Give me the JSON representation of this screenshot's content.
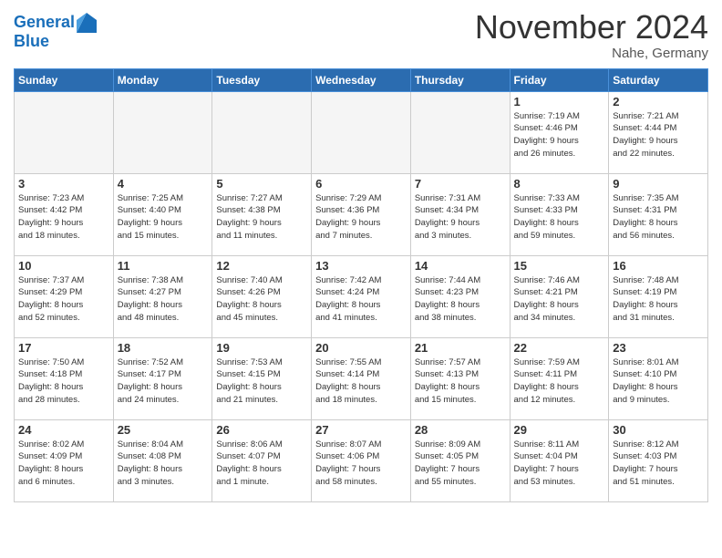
{
  "header": {
    "logo_line1": "General",
    "logo_line2": "Blue",
    "month": "November 2024",
    "location": "Nahe, Germany"
  },
  "weekdays": [
    "Sunday",
    "Monday",
    "Tuesday",
    "Wednesday",
    "Thursday",
    "Friday",
    "Saturday"
  ],
  "days": [
    {
      "num": "",
      "info": ""
    },
    {
      "num": "",
      "info": ""
    },
    {
      "num": "",
      "info": ""
    },
    {
      "num": "",
      "info": ""
    },
    {
      "num": "",
      "info": ""
    },
    {
      "num": "1",
      "info": "Sunrise: 7:19 AM\nSunset: 4:46 PM\nDaylight: 9 hours\nand 26 minutes."
    },
    {
      "num": "2",
      "info": "Sunrise: 7:21 AM\nSunset: 4:44 PM\nDaylight: 9 hours\nand 22 minutes."
    },
    {
      "num": "3",
      "info": "Sunrise: 7:23 AM\nSunset: 4:42 PM\nDaylight: 9 hours\nand 18 minutes."
    },
    {
      "num": "4",
      "info": "Sunrise: 7:25 AM\nSunset: 4:40 PM\nDaylight: 9 hours\nand 15 minutes."
    },
    {
      "num": "5",
      "info": "Sunrise: 7:27 AM\nSunset: 4:38 PM\nDaylight: 9 hours\nand 11 minutes."
    },
    {
      "num": "6",
      "info": "Sunrise: 7:29 AM\nSunset: 4:36 PM\nDaylight: 9 hours\nand 7 minutes."
    },
    {
      "num": "7",
      "info": "Sunrise: 7:31 AM\nSunset: 4:34 PM\nDaylight: 9 hours\nand 3 minutes."
    },
    {
      "num": "8",
      "info": "Sunrise: 7:33 AM\nSunset: 4:33 PM\nDaylight: 8 hours\nand 59 minutes."
    },
    {
      "num": "9",
      "info": "Sunrise: 7:35 AM\nSunset: 4:31 PM\nDaylight: 8 hours\nand 56 minutes."
    },
    {
      "num": "10",
      "info": "Sunrise: 7:37 AM\nSunset: 4:29 PM\nDaylight: 8 hours\nand 52 minutes."
    },
    {
      "num": "11",
      "info": "Sunrise: 7:38 AM\nSunset: 4:27 PM\nDaylight: 8 hours\nand 48 minutes."
    },
    {
      "num": "12",
      "info": "Sunrise: 7:40 AM\nSunset: 4:26 PM\nDaylight: 8 hours\nand 45 minutes."
    },
    {
      "num": "13",
      "info": "Sunrise: 7:42 AM\nSunset: 4:24 PM\nDaylight: 8 hours\nand 41 minutes."
    },
    {
      "num": "14",
      "info": "Sunrise: 7:44 AM\nSunset: 4:23 PM\nDaylight: 8 hours\nand 38 minutes."
    },
    {
      "num": "15",
      "info": "Sunrise: 7:46 AM\nSunset: 4:21 PM\nDaylight: 8 hours\nand 34 minutes."
    },
    {
      "num": "16",
      "info": "Sunrise: 7:48 AM\nSunset: 4:19 PM\nDaylight: 8 hours\nand 31 minutes."
    },
    {
      "num": "17",
      "info": "Sunrise: 7:50 AM\nSunset: 4:18 PM\nDaylight: 8 hours\nand 28 minutes."
    },
    {
      "num": "18",
      "info": "Sunrise: 7:52 AM\nSunset: 4:17 PM\nDaylight: 8 hours\nand 24 minutes."
    },
    {
      "num": "19",
      "info": "Sunrise: 7:53 AM\nSunset: 4:15 PM\nDaylight: 8 hours\nand 21 minutes."
    },
    {
      "num": "20",
      "info": "Sunrise: 7:55 AM\nSunset: 4:14 PM\nDaylight: 8 hours\nand 18 minutes."
    },
    {
      "num": "21",
      "info": "Sunrise: 7:57 AM\nSunset: 4:13 PM\nDaylight: 8 hours\nand 15 minutes."
    },
    {
      "num": "22",
      "info": "Sunrise: 7:59 AM\nSunset: 4:11 PM\nDaylight: 8 hours\nand 12 minutes."
    },
    {
      "num": "23",
      "info": "Sunrise: 8:01 AM\nSunset: 4:10 PM\nDaylight: 8 hours\nand 9 minutes."
    },
    {
      "num": "24",
      "info": "Sunrise: 8:02 AM\nSunset: 4:09 PM\nDaylight: 8 hours\nand 6 minutes."
    },
    {
      "num": "25",
      "info": "Sunrise: 8:04 AM\nSunset: 4:08 PM\nDaylight: 8 hours\nand 3 minutes."
    },
    {
      "num": "26",
      "info": "Sunrise: 8:06 AM\nSunset: 4:07 PM\nDaylight: 8 hours\nand 1 minute."
    },
    {
      "num": "27",
      "info": "Sunrise: 8:07 AM\nSunset: 4:06 PM\nDaylight: 7 hours\nand 58 minutes."
    },
    {
      "num": "28",
      "info": "Sunrise: 8:09 AM\nSunset: 4:05 PM\nDaylight: 7 hours\nand 55 minutes."
    },
    {
      "num": "29",
      "info": "Sunrise: 8:11 AM\nSunset: 4:04 PM\nDaylight: 7 hours\nand 53 minutes."
    },
    {
      "num": "30",
      "info": "Sunrise: 8:12 AM\nSunset: 4:03 PM\nDaylight: 7 hours\nand 51 minutes."
    },
    {
      "num": "",
      "info": ""
    }
  ]
}
